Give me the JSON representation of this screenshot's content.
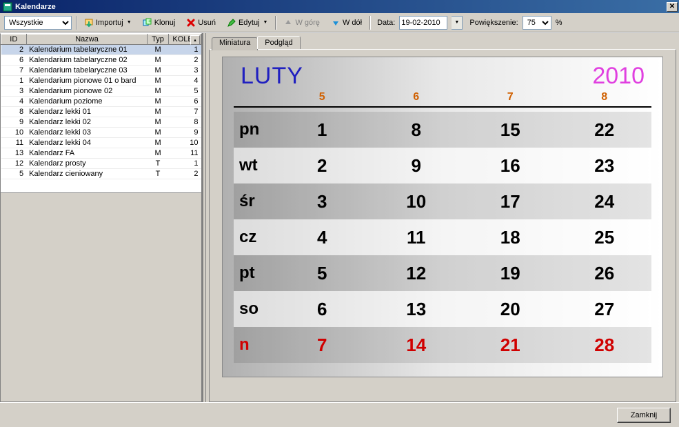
{
  "window": {
    "title": "Kalendarze"
  },
  "toolbar": {
    "filter_value": "Wszystkie",
    "import_label": "Importuj",
    "clone_label": "Klonuj",
    "delete_label": "Usuń",
    "edit_label": "Edytuj",
    "up_label": "W górę",
    "down_label": "W dół",
    "date_label": "Data:",
    "date_value": "19-02-2010",
    "zoom_label": "Powiększenie:",
    "zoom_value": "75",
    "zoom_suffix": "%"
  },
  "grid": {
    "headers": {
      "id": "ID",
      "name": "Nazwa",
      "typ": "Typ",
      "kolej": "KOLEJ"
    },
    "selected_id": "2",
    "rows": [
      {
        "id": "2",
        "name": "Kalendarium tabelaryczne 01",
        "typ": "M",
        "kolej": "1"
      },
      {
        "id": "6",
        "name": "Kalendarium tabelaryczne 02",
        "typ": "M",
        "kolej": "2"
      },
      {
        "id": "7",
        "name": "Kalendarium tabelaryczne 03",
        "typ": "M",
        "kolej": "3"
      },
      {
        "id": "1",
        "name": "Kalendarium pionowe 01 o bard",
        "typ": "M",
        "kolej": "4"
      },
      {
        "id": "3",
        "name": "Kalendarium pionowe 02",
        "typ": "M",
        "kolej": "5"
      },
      {
        "id": "4",
        "name": "Kalendarium poziome",
        "typ": "M",
        "kolej": "6"
      },
      {
        "id": "8",
        "name": "Kalendarz lekki 01",
        "typ": "M",
        "kolej": "7"
      },
      {
        "id": "9",
        "name": "Kalendarz lekki 02",
        "typ": "M",
        "kolej": "8"
      },
      {
        "id": "10",
        "name": "Kalendarz lekki 03",
        "typ": "M",
        "kolej": "9"
      },
      {
        "id": "11",
        "name": "Kalendarz lekki 04",
        "typ": "M",
        "kolej": "10"
      },
      {
        "id": "13",
        "name": "Kalendarz FA",
        "typ": "M",
        "kolej": "11"
      },
      {
        "id": "12",
        "name": "Kalendarz prosty",
        "typ": "T",
        "kolej": "1"
      },
      {
        "id": "5",
        "name": "Kalendarz cieniowany",
        "typ": "T",
        "kolej": "2"
      }
    ]
  },
  "tabs": {
    "miniature": "Miniatura",
    "preview": "Podgląd",
    "active": "preview"
  },
  "calendar": {
    "month": "LUTY",
    "year": "2010",
    "week_numbers": [
      "5",
      "6",
      "7",
      "8"
    ],
    "rows": [
      {
        "dow": "pn",
        "sunday": false,
        "cells": [
          "1",
          "8",
          "15",
          "22"
        ]
      },
      {
        "dow": "wt",
        "sunday": false,
        "cells": [
          "2",
          "9",
          "16",
          "23"
        ]
      },
      {
        "dow": "śr",
        "sunday": false,
        "cells": [
          "3",
          "10",
          "17",
          "24"
        ]
      },
      {
        "dow": "cz",
        "sunday": false,
        "cells": [
          "4",
          "11",
          "18",
          "25"
        ]
      },
      {
        "dow": "pt",
        "sunday": false,
        "cells": [
          "5",
          "12",
          "19",
          "26"
        ]
      },
      {
        "dow": "so",
        "sunday": false,
        "cells": [
          "6",
          "13",
          "20",
          "27"
        ]
      },
      {
        "dow": "n",
        "sunday": true,
        "cells": [
          "7",
          "14",
          "21",
          "28"
        ]
      }
    ]
  },
  "footer": {
    "close_label": "Zamknij"
  }
}
